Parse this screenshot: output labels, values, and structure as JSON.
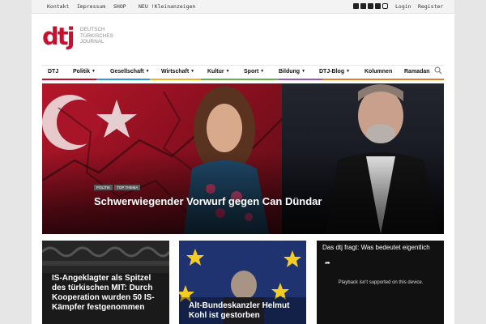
{
  "topbar": {
    "links": [
      "Kontakt",
      "Impressum",
      "SHOP",
      "NEU !Kleinanzeigen"
    ],
    "social_icons": [
      "facebook-icon",
      "twitter-icon",
      "youtube-icon",
      "google-plus-icon",
      "instagram-icon"
    ],
    "login": "Login",
    "register": "Register"
  },
  "logo": {
    "mark": "dtj",
    "line1": "DEUTSCH",
    "line2": "TÜRKISCHES",
    "line3": "JOURNAL",
    "color": "#c8102e"
  },
  "nav": {
    "items": [
      {
        "label": "DTJ"
      },
      {
        "label": "Politik"
      },
      {
        "label": "Gesellschaft"
      },
      {
        "label": "Wirtschaft"
      },
      {
        "label": "Kultur"
      },
      {
        "label": "Sport"
      },
      {
        "label": "Bildung"
      },
      {
        "label": "DTJ-Blog"
      },
      {
        "label": "Kolumnen"
      },
      {
        "label": "Ramadan"
      }
    ],
    "search_icon": "search-icon",
    "stripe_colors": [
      "#c8102e",
      "#2f9bd6",
      "#f0b323",
      "#6ab04c",
      "#9b59b6",
      "#e67e22"
    ]
  },
  "hero": {
    "tags": [
      "Politik",
      "Top Thema"
    ],
    "headline": "Schwerwiegender Vorwurf gegen Can Dündar"
  },
  "cards": [
    {
      "title": "IS-Angeklagter als Spitzel des türkischen MIT: Durch Kooperation wurden 50 IS-Kämpfer festgenommen"
    },
    {
      "title": "Alt-Bundeskanzler Helmut Kohl ist gestorben"
    }
  ],
  "video": {
    "title": "Das dtj fragt: Was bedeutet eigentlich",
    "notice": "Playback isn't supported on this device."
  }
}
